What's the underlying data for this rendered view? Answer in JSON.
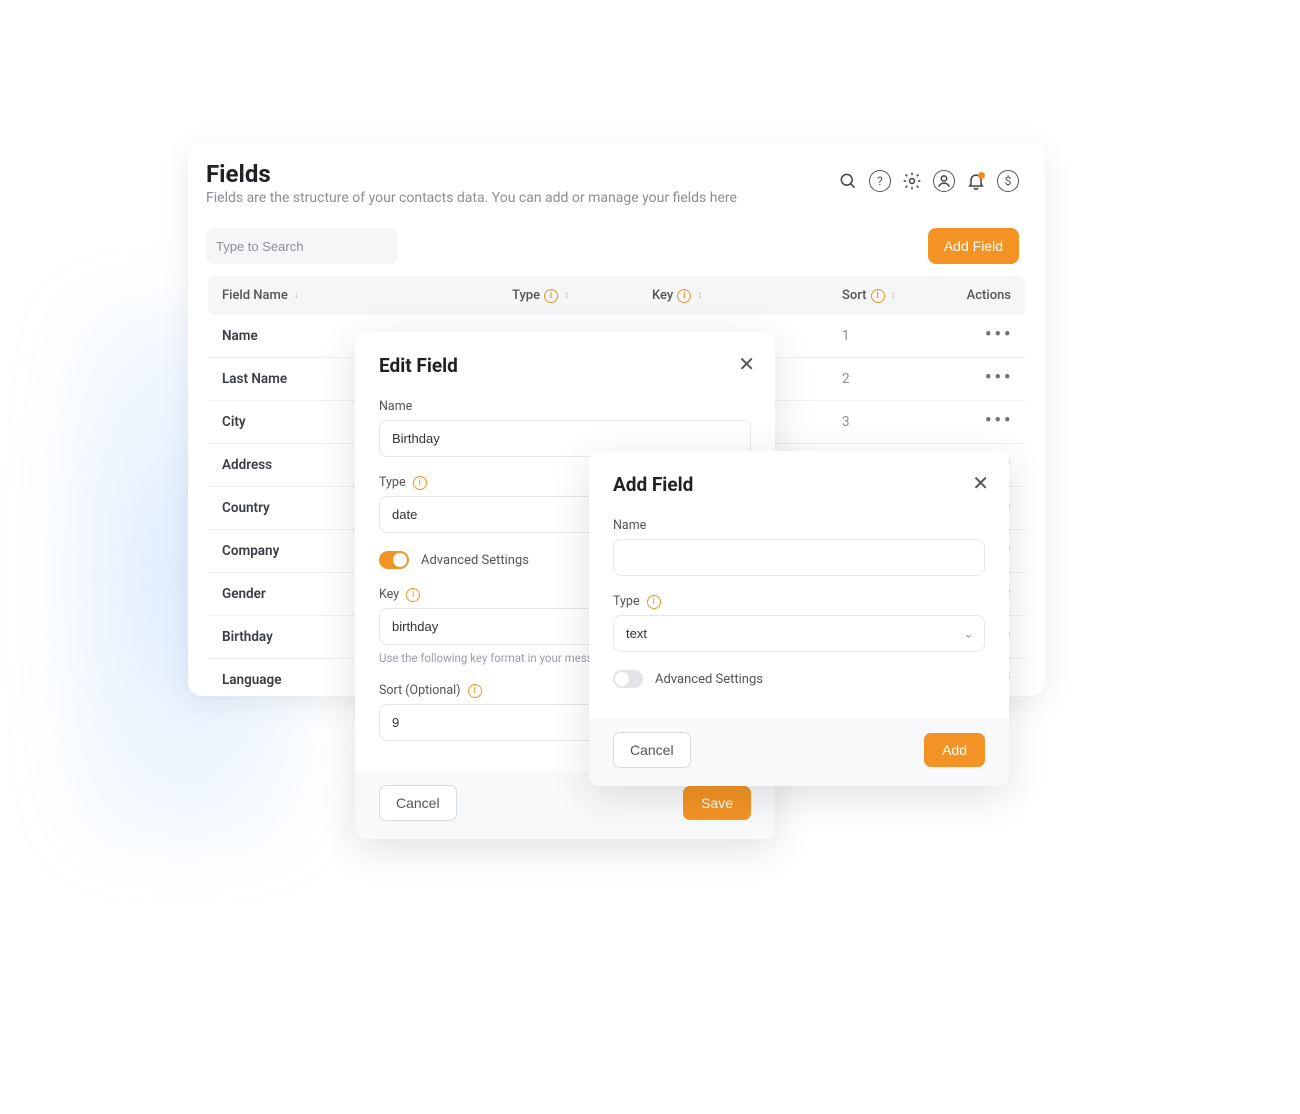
{
  "header": {
    "title": "Fields",
    "subtitle": "Fields are the structure of your contacts data. You can add or manage your fields here"
  },
  "search": {
    "placeholder": "Type to Search"
  },
  "addFieldBtn": "Add Field",
  "table": {
    "columns": {
      "name": "Field Name",
      "type": "Type",
      "key": "Key",
      "sort": "Sort",
      "actions": "Actions"
    },
    "rows": [
      {
        "name": "Name",
        "sort": "1"
      },
      {
        "name": "Last Name",
        "sort": "2"
      },
      {
        "name": "City",
        "sort": "3"
      },
      {
        "name": "Address",
        "sort": ""
      },
      {
        "name": "Country",
        "sort": ""
      },
      {
        "name": "Company",
        "sort": ""
      },
      {
        "name": "Gender",
        "sort": ""
      },
      {
        "name": "Birthday",
        "sort": ""
      },
      {
        "name": "Language",
        "sort": ""
      }
    ]
  },
  "editModal": {
    "title": "Edit Field",
    "nameLabel": "Name",
    "nameValue": "Birthday",
    "typeLabel": "Type",
    "typeValue": "date",
    "advancedLabel": "Advanced Settings",
    "keyLabel": "Key",
    "keyValue": "birthday",
    "keyHint": "Use the following key format in your message:",
    "sortLabel": "Sort (Optional)",
    "sortValue": "9",
    "cancel": "Cancel",
    "save": "Save"
  },
  "addModal": {
    "title": "Add Field",
    "nameLabel": "Name",
    "nameValue": "",
    "typeLabel": "Type",
    "typeValue": "text",
    "advancedLabel": "Advanced Settings",
    "cancel": "Cancel",
    "add": "Add"
  }
}
